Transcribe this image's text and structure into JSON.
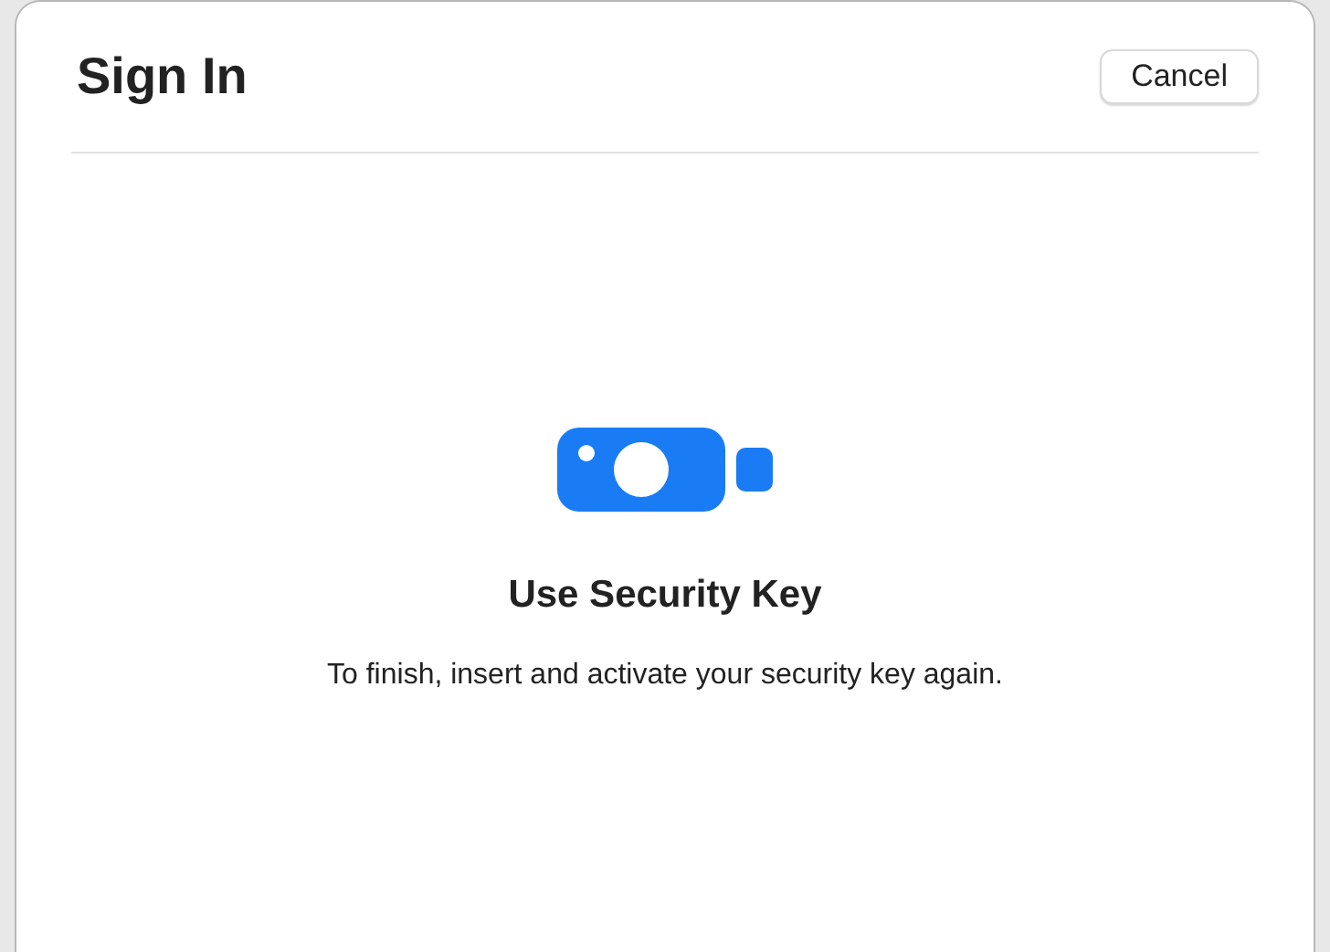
{
  "dialog": {
    "title": "Sign In",
    "cancel_button": "Cancel",
    "heading": "Use Security Key",
    "message": "To finish, insert and activate your security key again."
  }
}
